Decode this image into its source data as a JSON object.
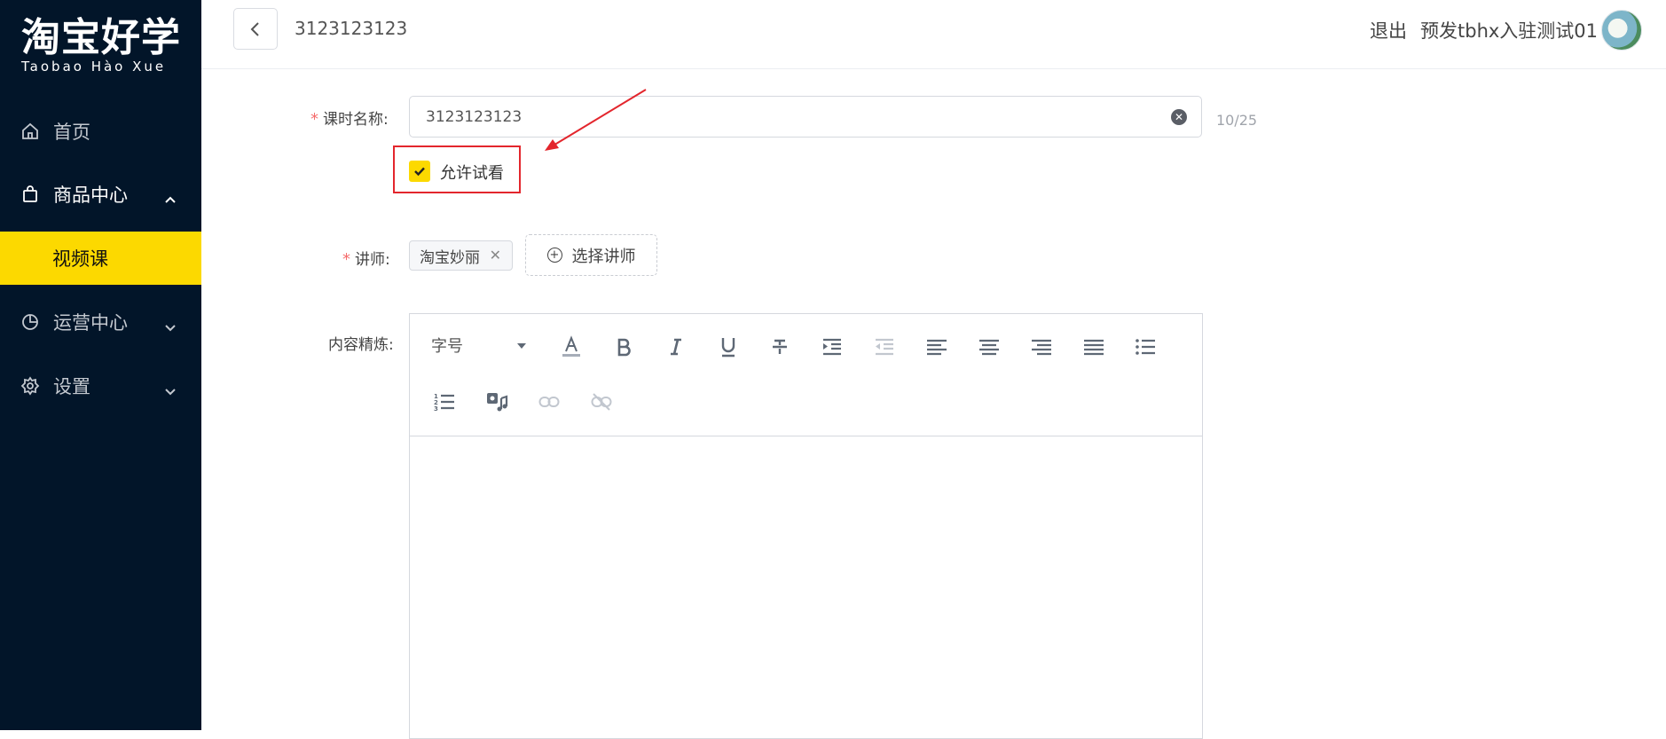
{
  "logo": {
    "cn": "淘宝好学",
    "en": "Taobao Hào Xue"
  },
  "sidebar": {
    "items": [
      {
        "label": "首页",
        "icon": "home-icon"
      },
      {
        "label": "商品中心",
        "icon": "shopping-bag-icon",
        "expanded": true
      },
      {
        "label": "视频课",
        "active": true
      },
      {
        "label": "运营中心",
        "icon": "pie-chart-icon"
      },
      {
        "label": "设置",
        "icon": "gear-icon"
      }
    ]
  },
  "header": {
    "title": "3123123123",
    "logout": "退出",
    "username": "预发tbhx入驻测试01"
  },
  "form": {
    "lesson_name_label": "课时名称:",
    "lesson_name_value": "3123123123",
    "lesson_name_counter": "10/25",
    "allow_preview_label": "允许试看",
    "allow_preview_checked": true,
    "teacher_label": "讲师:",
    "teacher_tag": "淘宝妙丽",
    "choose_teacher": "选择讲师",
    "content_label": "内容精炼:"
  },
  "editor": {
    "font_size_label": "字号",
    "tools": [
      "font-color-icon",
      "bold-icon",
      "italic-icon",
      "underline-icon",
      "strikethrough-icon",
      "indent-icon",
      "outdent-icon",
      "align-left-icon",
      "align-center-icon",
      "align-right-icon",
      "justify-icon",
      "bullet-list-icon",
      "ordered-list-icon",
      "media-icon",
      "link-icon",
      "unlink-icon"
    ]
  },
  "colors": {
    "sidebar_bg": "#021529",
    "accent": "#fcd900",
    "highlight": "#e3262d"
  }
}
